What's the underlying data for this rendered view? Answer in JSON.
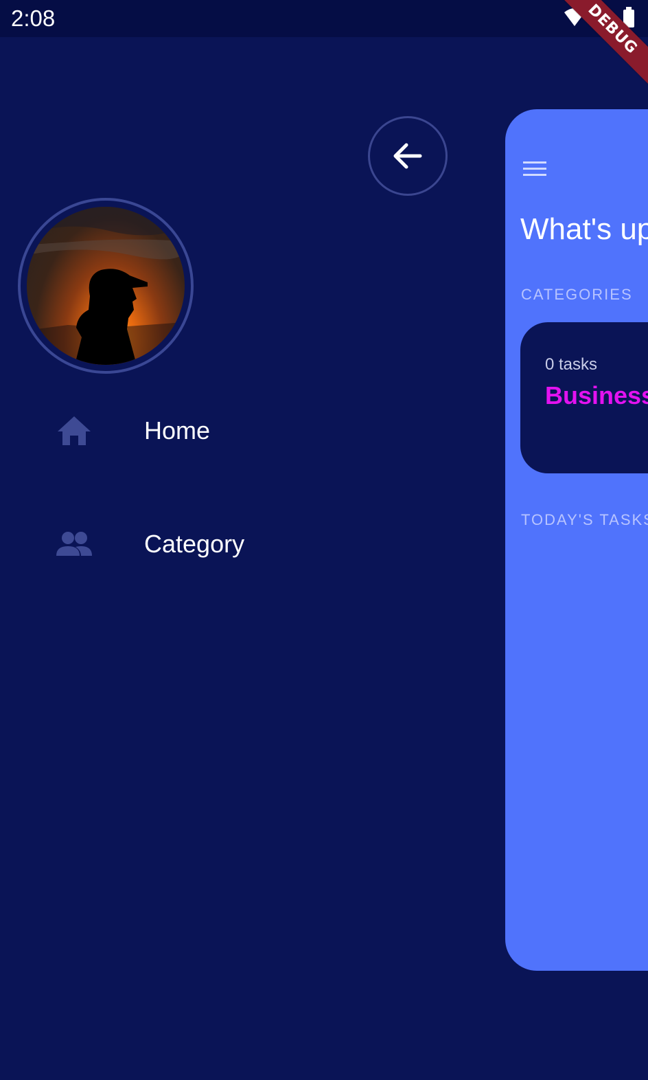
{
  "status_bar": {
    "time": "2:08",
    "icons": [
      "wifi-icon",
      "cell-signal-icon",
      "battery-icon"
    ],
    "debug_banner": "DEBUG"
  },
  "drawer": {
    "back_icon": "arrow-left-icon",
    "menu": [
      {
        "label": "Home",
        "icon": "home-icon"
      },
      {
        "label": "Category",
        "icon": "people-icon"
      }
    ]
  },
  "main": {
    "menu_icon": "hamburger-icon",
    "greeting": "What's up",
    "categories_label": "CATEGORIES",
    "category_card": {
      "count": "0 tasks",
      "name": "Business"
    },
    "tasks_label": "TODAY'S TASKS"
  },
  "colors": {
    "background": "#0a1456",
    "status_bar": "#050d45",
    "panel": "#5073fc",
    "accent_magenta": "#e312f0",
    "debug_banner": "#8a1b2c"
  }
}
